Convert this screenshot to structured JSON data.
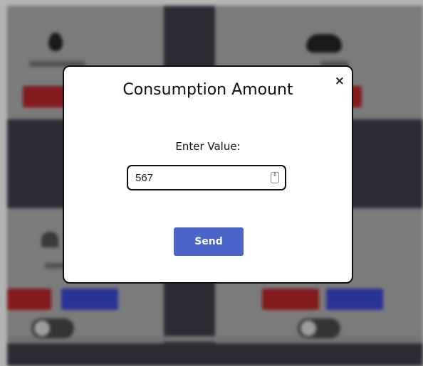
{
  "modal": {
    "title": "Consumption Amount",
    "close_glyph": "×",
    "field_label": "Enter Value:",
    "input_value": "567",
    "spinner_glyph": "⇕",
    "send_label": "Send"
  },
  "background": {
    "card_icons": [
      "water-drop-icon",
      "cloud-icon",
      "wifi-icon"
    ],
    "accent_red": "#b5141a",
    "accent_blue": "#2a3ad0",
    "button_color": "#4a64c7"
  }
}
